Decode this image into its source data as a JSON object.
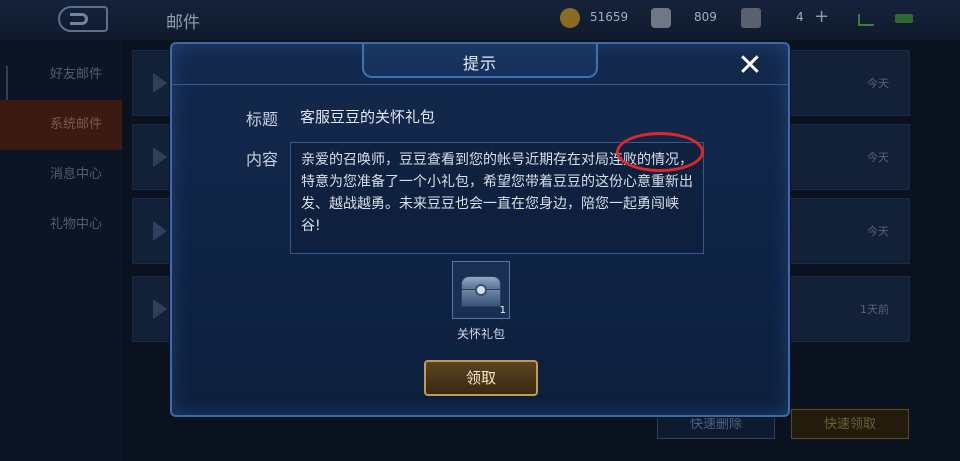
{
  "topbar": {
    "title": "邮件",
    "gold": "51659",
    "diamond": "809",
    "tickets": "4"
  },
  "sidebar": {
    "items": [
      {
        "label": "好友邮件",
        "active": false
      },
      {
        "label": "系统邮件",
        "active": true
      },
      {
        "label": "消息中心",
        "active": false
      },
      {
        "label": "礼物中心",
        "active": false
      }
    ]
  },
  "mail_list": {
    "dates": [
      "今天",
      "今天",
      "今天",
      "1天前"
    ]
  },
  "bottom_buttons": {
    "quick_delete": "快速删除",
    "quick_claim": "快速领取"
  },
  "dialog": {
    "title": "提示",
    "close_icon": "close-icon",
    "subject_label": "标题",
    "subject": "客服豆豆的关怀礼包",
    "content_label": "内容",
    "content": "亲爱的召唤师，豆豆查看到您的帐号近期存在对局连败的情况，特意为您准备了一个小礼包，希望您带着豆豆的这份心意重新出发、越战越勇。未来豆豆也会一直在您身边，陪您一起勇闯峡谷!",
    "highlight_color": "#e0262a",
    "item": {
      "name": "关怀礼包",
      "count": "1",
      "icon": "treasure-chest-icon"
    },
    "claim_label": "领取"
  },
  "colors": {
    "dialog_border": "#3e6aa6",
    "claim_border": "#c39a4f"
  }
}
